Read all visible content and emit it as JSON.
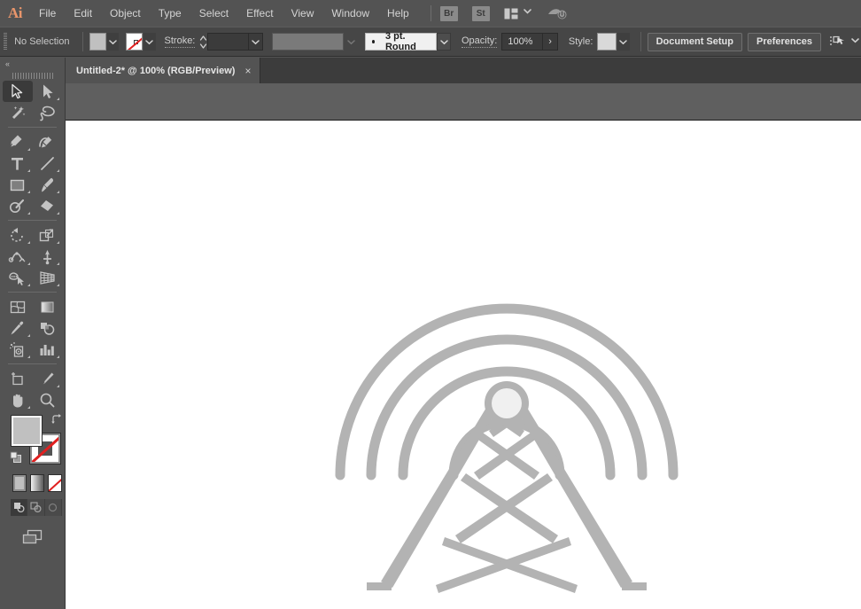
{
  "app": {
    "name": "Ai",
    "logo_color": "#e8956b"
  },
  "menubar": {
    "items": [
      "File",
      "Edit",
      "Object",
      "Type",
      "Select",
      "Effect",
      "View",
      "Window",
      "Help"
    ],
    "bridge_badge": "Br",
    "stock_badge": "St",
    "arrange_icon": "arrange-documents-icon",
    "arrange_chevron": "chevron-down-icon",
    "cloud_icon": "cloud-sync-icon"
  },
  "controlbar": {
    "grip": "panel-grip",
    "selection_status": "No Selection",
    "fill_swatch": {
      "name": "fill-swatch",
      "color": "#c0c0c0"
    },
    "fill_dropdown": "chevron-down-icon",
    "stroke_swatch": {
      "name": "stroke-swatch",
      "color": "none"
    },
    "stroke_dropdown": "chevron-down-icon",
    "stroke_label": "Stroke:",
    "stroke_stepper": "stroke-weight-stepper",
    "stroke_weight": "",
    "stroke_weight_dropdown": "chevron-down-icon",
    "width_profile": {
      "name": "variable-width-profile",
      "value": "",
      "disabled": true
    },
    "width_profile_dropdown": "chevron-down-icon",
    "brush_definition": "3 pt. Round",
    "brush_dropdown": "chevron-down-icon",
    "opacity_label": "Opacity:",
    "opacity_value": "100%",
    "opacity_arrow": "chevron-right-icon",
    "style_label": "Style:",
    "style_swatch": {
      "name": "graphic-style-swatch",
      "color": "#d9d9d9"
    },
    "style_dropdown": "chevron-down-icon",
    "document_setup_button": "Document Setup",
    "preferences_button": "Preferences",
    "align_icon": "align-to-selection-icon",
    "align_chevron": "chevron-down-icon"
  },
  "tabbar": {
    "tab_title": "Untitled-2* @ 100% (RGB/Preview)",
    "tab_close": "×"
  },
  "toolbar": {
    "collapse": "«",
    "collapse_name": "collapse-panel-icon",
    "grip": "toolbar-grip",
    "tools": [
      {
        "name": "selection-tool",
        "active": true,
        "flyout": false
      },
      {
        "name": "direct-selection-tool",
        "active": false,
        "flyout": true
      },
      {
        "name": "magic-wand-tool",
        "active": false,
        "flyout": false
      },
      {
        "name": "lasso-tool",
        "active": false,
        "flyout": false
      },
      {
        "name": "pen-tool",
        "active": false,
        "flyout": true
      },
      {
        "name": "curvature-tool",
        "active": false,
        "flyout": false
      },
      {
        "name": "type-tool",
        "active": false,
        "flyout": true
      },
      {
        "name": "line-segment-tool",
        "active": false,
        "flyout": true
      },
      {
        "name": "rectangle-tool",
        "active": false,
        "flyout": true
      },
      {
        "name": "paintbrush-tool",
        "active": false,
        "flyout": true
      },
      {
        "name": "shaper-tool",
        "active": false,
        "flyout": true
      },
      {
        "name": "eraser-tool",
        "active": false,
        "flyout": true
      },
      {
        "name": "rotate-tool",
        "active": false,
        "flyout": true
      },
      {
        "name": "scale-tool",
        "active": false,
        "flyout": true
      },
      {
        "name": "width-tool",
        "active": false,
        "flyout": true
      },
      {
        "name": "free-transform-tool",
        "active": false,
        "flyout": true
      },
      {
        "name": "shape-builder-tool",
        "active": false,
        "flyout": true
      },
      {
        "name": "perspective-grid-tool",
        "active": false,
        "flyout": true
      },
      {
        "name": "mesh-tool",
        "active": false,
        "flyout": false
      },
      {
        "name": "gradient-tool",
        "active": false,
        "flyout": false
      },
      {
        "name": "eyedropper-tool",
        "active": false,
        "flyout": true
      },
      {
        "name": "blend-tool",
        "active": false,
        "flyout": false
      },
      {
        "name": "symbol-sprayer-tool",
        "active": false,
        "flyout": true
      },
      {
        "name": "column-graph-tool",
        "active": false,
        "flyout": true
      },
      {
        "name": "artboard-tool",
        "active": false,
        "flyout": false
      },
      {
        "name": "slice-tool",
        "active": false,
        "flyout": true
      },
      {
        "name": "hand-tool",
        "active": false,
        "flyout": true
      },
      {
        "name": "zoom-tool",
        "active": false,
        "flyout": false
      }
    ],
    "fill_swatch": {
      "name": "fill-color-swatch",
      "color": "#c0c0c0"
    },
    "stroke_swatch": {
      "name": "stroke-color-swatch",
      "color": "none"
    },
    "swap_icon": "swap-fill-stroke-icon",
    "default_icon": "default-fill-stroke-icon",
    "modes": [
      {
        "name": "color-mode-button",
        "selected": true
      },
      {
        "name": "gradient-mode-button",
        "selected": false
      },
      {
        "name": "none-mode-button",
        "selected": false
      }
    ],
    "draw_modes": [
      {
        "name": "draw-normal-button",
        "selected": true
      },
      {
        "name": "draw-behind-button",
        "selected": false
      },
      {
        "name": "draw-inside-button",
        "selected": false
      }
    ],
    "screen_mode": "change-screen-mode-button"
  },
  "canvas": {
    "artboard_background": "#ffffff",
    "artwork_name": "radio-tower-artwork",
    "artwork_color": "#b3b3b3",
    "hub_fill": "#f0f0f0",
    "arc_count": 4
  }
}
